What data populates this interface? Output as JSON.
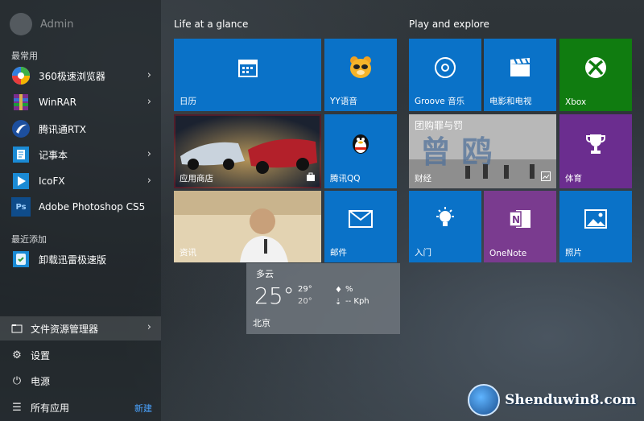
{
  "user": {
    "name": "Admin"
  },
  "left": {
    "most_used_label": "最常用",
    "most_used": [
      {
        "label": "360极速浏览器",
        "icon": "360-browser-icon",
        "has_arrow": true
      },
      {
        "label": "WinRAR",
        "icon": "winrar-icon",
        "has_arrow": true
      },
      {
        "label": "腾讯通RTX",
        "icon": "rtx-icon",
        "has_arrow": false
      },
      {
        "label": "记事本",
        "icon": "notepad-icon",
        "has_arrow": true
      },
      {
        "label": "IcoFX",
        "icon": "icofx-icon",
        "has_arrow": true
      },
      {
        "label": "Adobe Photoshop CS5",
        "icon": "photoshop-icon",
        "has_arrow": false
      }
    ],
    "recent_label": "最近添加",
    "recent": [
      {
        "label": "卸载迅雷极速版",
        "icon": "uninstall-icon"
      }
    ],
    "system": {
      "explorer": "文件资源管理器",
      "settings": "设置",
      "power": "电源",
      "all_apps": "所有应用",
      "new_badge": "新建"
    }
  },
  "groups": {
    "life": "Life at a glance",
    "play": "Play and explore"
  },
  "tiles": {
    "calendar": "日历",
    "yy": "YY语音",
    "store": "应用商店",
    "qq": "腾讯QQ",
    "news": "资讯",
    "mail": "邮件",
    "groove": "Groove 音乐",
    "movies": "电影和电视",
    "xbox": "Xbox",
    "finance": "财经",
    "finance_headline": "团购罪与罚",
    "sports": "体育",
    "getstarted": "入门",
    "onenote": "OneNote",
    "photos": "照片"
  },
  "weather": {
    "condition": "多云",
    "temp": "25°",
    "high": "29°",
    "low": "20°",
    "humidity": "%",
    "wind": "-- Kph",
    "city": "北京"
  },
  "watermark": {
    "text": "Shenduwin8.com"
  },
  "colors": {
    "tile_blue": "#0a72c8",
    "xbox_green": "#107c10",
    "purple": "#6b2d8f",
    "onenote": "#7a3b8f",
    "selected_outline": "#d4111b",
    "new_link": "#4aa3ff"
  }
}
